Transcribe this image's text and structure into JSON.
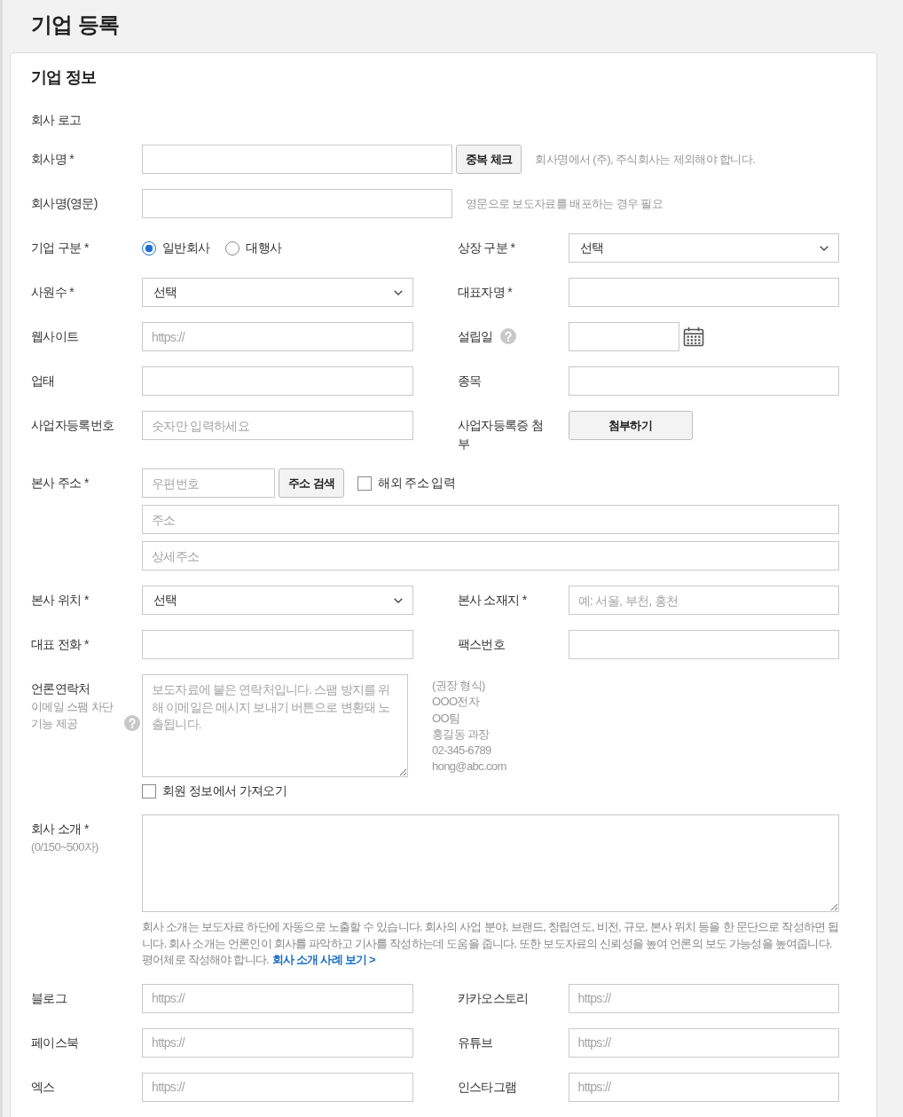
{
  "page": {
    "title": "기업 등록"
  },
  "section": {
    "title": "기업 정보",
    "rows": [
      {
        "kind": "label",
        "label": "회사 로고"
      },
      {
        "kind": "single",
        "fields": [
          {
            "label": "회사명 *",
            "controls": [
              {
                "kind": "text"
              },
              {
                "kind": "button",
                "label": "중복 체크"
              },
              {
                "kind": "hint",
                "text": "회사명에서 (주), 주식회사는 제외해야 합니다."
              }
            ]
          }
        ]
      },
      {
        "kind": "single",
        "fields": [
          {
            "label": "회사명(영문)",
            "controls": [
              {
                "kind": "text"
              },
              {
                "kind": "hint",
                "text": "영문으로 보도자료를 배포하는 경우 필요"
              }
            ]
          }
        ]
      },
      {
        "kind": "pair",
        "fields": [
          {
            "label": "기업 구분 *",
            "controls": [
              {
                "kind": "radio",
                "options": [
                  {
                    "label": "일반회사",
                    "selected": true
                  },
                  {
                    "label": "대행사",
                    "selected": false
                  }
                ]
              }
            ]
          },
          {
            "label": "상장 구분 *",
            "controls": [
              {
                "kind": "select",
                "value": "선택"
              }
            ]
          }
        ]
      },
      {
        "kind": "pair",
        "fields": [
          {
            "label": "사원수 *",
            "controls": [
              {
                "kind": "select",
                "value": "선택"
              }
            ]
          },
          {
            "label": "대표자명 *",
            "controls": [
              {
                "kind": "text"
              }
            ]
          }
        ]
      },
      {
        "kind": "pair",
        "fields": [
          {
            "label": "웹사이트",
            "controls": [
              {
                "kind": "text",
                "placeholder": "https://"
              }
            ]
          },
          {
            "label": "설립일",
            "help": true,
            "controls": [
              {
                "kind": "date"
              }
            ]
          }
        ]
      },
      {
        "kind": "pair",
        "fields": [
          {
            "label": "업태",
            "controls": [
              {
                "kind": "text"
              }
            ]
          },
          {
            "label": "종목",
            "controls": [
              {
                "kind": "text"
              }
            ]
          }
        ]
      },
      {
        "kind": "pair",
        "fields": [
          {
            "label": "사업자등록번호",
            "controls": [
              {
                "kind": "text",
                "placeholder": "숫자만 입력하세요"
              }
            ]
          },
          {
            "label": "사업자등록증 첨부",
            "controls": [
              {
                "kind": "button",
                "label": "첨부하기"
              }
            ]
          }
        ]
      },
      {
        "kind": "address",
        "fields": [
          {
            "label": "본사 주소 *",
            "controls": [
              {
                "kind": "text",
                "placeholder": "우편번호"
              },
              {
                "kind": "button",
                "label": "주소 검색"
              },
              {
                "kind": "checkbox",
                "label": "해외 주소 입력",
                "checked": false
              },
              {
                "kind": "text",
                "placeholder": "주소"
              },
              {
                "kind": "text",
                "placeholder": "상세주소"
              }
            ]
          }
        ]
      },
      {
        "kind": "pair",
        "fields": [
          {
            "label": "본사 위치 *",
            "controls": [
              {
                "kind": "select",
                "value": "선택"
              }
            ]
          },
          {
            "label": "본사 소재지 *",
            "controls": [
              {
                "kind": "text",
                "placeholder": "예: 서울, 부천, 홍천"
              }
            ]
          }
        ]
      },
      {
        "kind": "pair",
        "fields": [
          {
            "label": "대표 전화 *",
            "controls": [
              {
                "kind": "text"
              }
            ]
          },
          {
            "label": "팩스번호",
            "controls": [
              {
                "kind": "text"
              }
            ]
          }
        ]
      },
      {
        "kind": "contact",
        "fields": [
          {
            "label": "언론연락처",
            "note": "이메일 스팸 차단 기능 제공",
            "help": true,
            "controls": [
              {
                "kind": "textarea",
                "placeholder": "보도자료에 붙은 연락처입니다. 스팸 방지를 위해 이메일은 메시지 보내기 버튼으로 변환돼 노출됩니다."
              },
              {
                "kind": "example",
                "lines": [
                  "(권장 형식)",
                  "OOO전자",
                  "OO팀",
                  "홍길동 과장",
                  "02-345-6789",
                  "hong@abc.com"
                ]
              },
              {
                "kind": "checkbox",
                "label": "회원 정보에서 가져오기",
                "checked": false
              }
            ]
          }
        ]
      },
      {
        "kind": "intro",
        "fields": [
          {
            "label": "회사 소개 *",
            "note": "(0/150~500자)",
            "controls": [
              {
                "kind": "textarea"
              },
              {
                "kind": "notice",
                "text": "회사 소개는 보도자료 하단에 자동으로 노출할 수 있습니다. 회사의 사업 분야, 브랜드, 창립연도, 비전, 규모, 본사 위치 등을 한 문단으로 작성하면 됩니다. 회사 소개는 언론인이 회사를 파악하고 기사를 작성하는데 도움을 줍니다. 또한 보도자료의 신뢰성을 높여 언론의 보도 가능성을 높여줍니다. 평어체로 작성해야 합니다.",
                "link": "회사 소개 사례 보기 >"
              }
            ]
          }
        ]
      },
      {
        "kind": "pair",
        "fields": [
          {
            "label": "블로그",
            "controls": [
              {
                "kind": "text",
                "placeholder": "https://"
              }
            ]
          },
          {
            "label": "카카오스토리",
            "controls": [
              {
                "kind": "text",
                "placeholder": "https://"
              }
            ]
          }
        ]
      },
      {
        "kind": "pair",
        "fields": [
          {
            "label": "페이스북",
            "controls": [
              {
                "kind": "text",
                "placeholder": "https://"
              }
            ]
          },
          {
            "label": "유튜브",
            "controls": [
              {
                "kind": "text",
                "placeholder": "https://"
              }
            ]
          }
        ]
      },
      {
        "kind": "pair",
        "fields": [
          {
            "label": "엑스",
            "controls": [
              {
                "kind": "text",
                "placeholder": "https://"
              }
            ]
          },
          {
            "label": "인스타그램",
            "controls": [
              {
                "kind": "text",
                "placeholder": "https://"
              }
            ]
          }
        ]
      }
    ]
  }
}
